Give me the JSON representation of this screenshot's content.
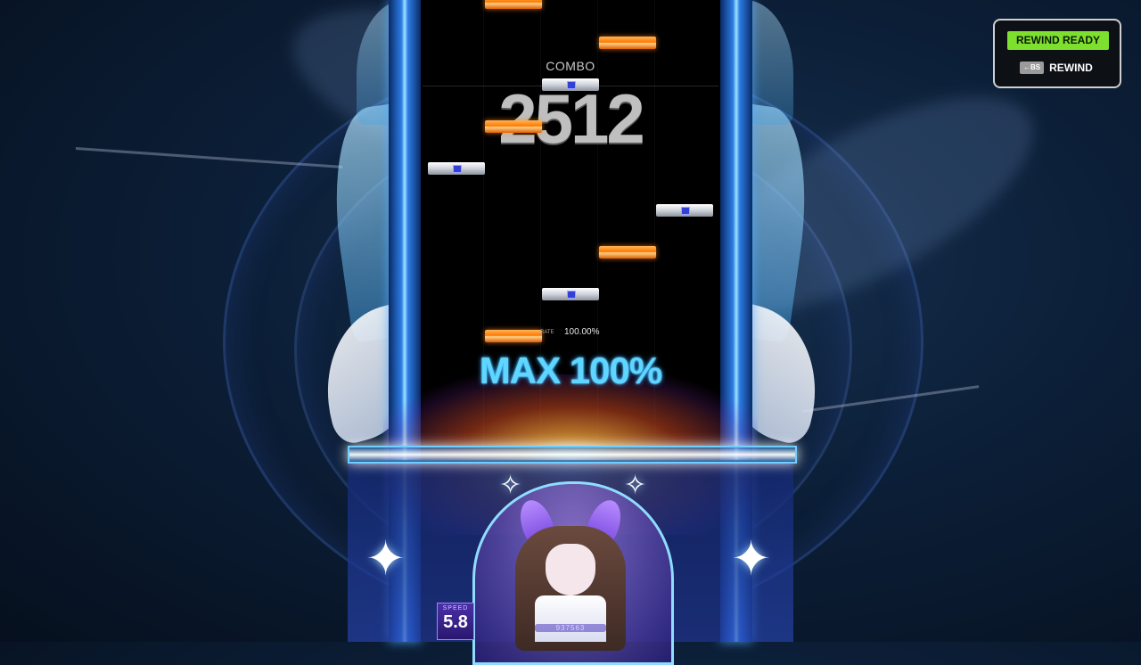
{
  "hud": {
    "combo_label": "COMBO",
    "combo_value": "2512",
    "rate_label": "RATE",
    "rate_value": "100.00%",
    "judgement": "MAX 100%",
    "speed_label": "SPEED",
    "speed_value": "5.8",
    "score": "937563"
  },
  "rewind": {
    "ready_label": "REWIND READY",
    "key_label": "←BS",
    "action_label": "REWIND"
  },
  "colors": {
    "rewind_ready_bg": "#7ee02e",
    "note_orange": "#ff7a00",
    "note_silver": "#cfd3da",
    "judgement_text": "#5fd6ff"
  }
}
